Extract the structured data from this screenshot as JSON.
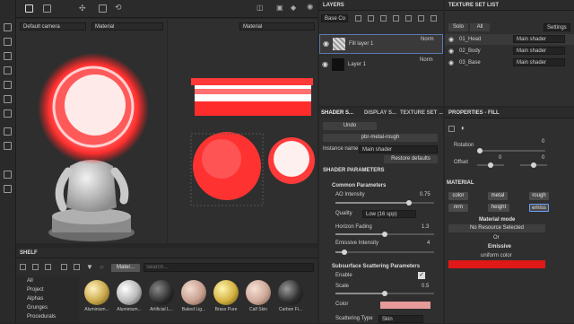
{
  "viewport3d": {
    "camera": "Default camera",
    "channel": "Material"
  },
  "viewport2d": {
    "channel": "Material"
  },
  "layers": {
    "title": "LAYERS",
    "channel_select": "Base Co",
    "items": [
      {
        "name": "Fill layer 1",
        "blend": "Norm"
      },
      {
        "name": "Layer 1",
        "blend": "Norm"
      }
    ]
  },
  "texture_sets": {
    "title": "TEXTURE SET LIST",
    "solo": "Solo",
    "all": "All",
    "settings": "Settings",
    "items": [
      {
        "name": "01_Head",
        "shader": "Main shader"
      },
      {
        "name": "02_Body",
        "shader": "Main shader"
      },
      {
        "name": "03_Base",
        "shader": "Main shader"
      }
    ]
  },
  "shader": {
    "tabs": [
      "SHADER S...",
      "DISPLAY S...",
      "TEXTURE SET ..."
    ],
    "undo": "Undo",
    "preset": "pbr-metal-rough",
    "instance_label": "Instance name",
    "instance_value": "Main shader",
    "restore": "Restore defaults",
    "section": "SHADER PARAMETERS",
    "common": "Common Parameters",
    "ao_label": "AO Intensity",
    "ao_value": "0.75",
    "ao_fraction": 0.75,
    "quality_label": "Quality",
    "quality_value": "Low (16 spp)",
    "horizon_label": "Horizon Fading",
    "horizon_value": "1.3",
    "emissive_label": "Emissive Intensity",
    "emissive_value": "4",
    "sss_title": "Subsurface Scattering Parameters",
    "enable_label": "Enable",
    "scale_label": "Scale",
    "scale_value": "0.5",
    "color_label": "Color",
    "sss_color": "#e79a9a",
    "scattering_label": "Scattering Type",
    "scattering_value": "Skin"
  },
  "properties": {
    "title": "PROPERTIES - FILL",
    "rotation_label": "Rotation",
    "rotation_value": "0",
    "offset_label": "Offset",
    "offset_x": "0",
    "offset_y": "0",
    "material_title": "MATERIAL",
    "channels": [
      "color",
      "metal",
      "rough",
      "nrm",
      "height",
      "emiss"
    ],
    "material_mode": "Material mode",
    "no_resource": "No Resource Selected",
    "or": "Or",
    "emissive_title": "Emissive",
    "emissive_sub": "uniform color",
    "emissive_color": "#e01818"
  },
  "shelf": {
    "title": "SHELF",
    "filter_chip": "Mater...",
    "search_placeholder": "Search...",
    "categories": [
      "All",
      "Project",
      "Alphas",
      "Grunges",
      "Procedurals"
    ],
    "materials": [
      {
        "name": "Aluminium...",
        "color": "#c9a84a"
      },
      {
        "name": "Aluminium...",
        "color": "#b8b8b8"
      },
      {
        "name": "Artificial L...",
        "color": "#2a2a2a"
      },
      {
        "name": "Baked Lig...",
        "color": "#c8a090"
      },
      {
        "name": "Brass Pure",
        "color": "#d4b040"
      },
      {
        "name": "Calf Skin",
        "color": "#cda898"
      },
      {
        "name": "Carbon Fi...",
        "color": "#303030"
      }
    ]
  }
}
